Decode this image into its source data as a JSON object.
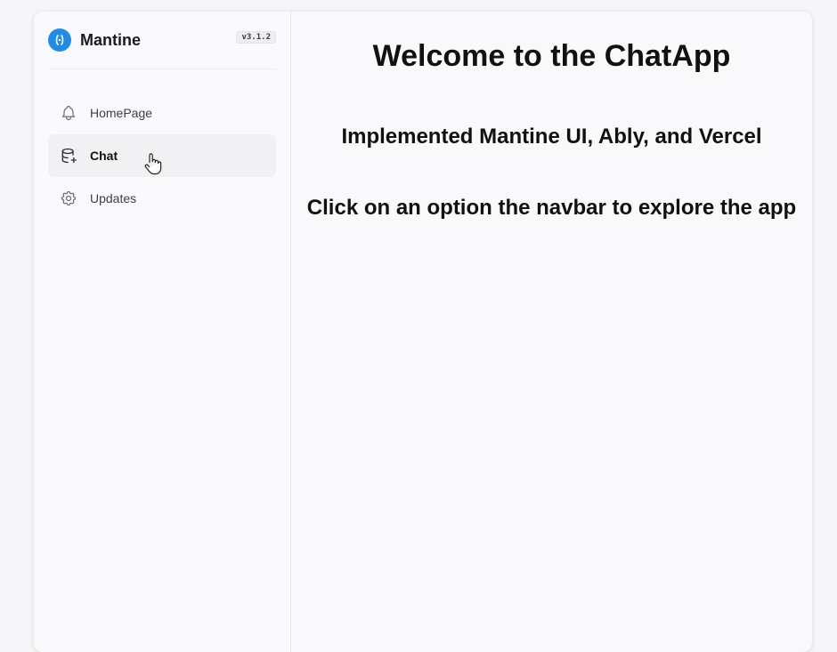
{
  "navbar": {
    "brand": "Mantine",
    "version": "v3.1.2",
    "items": [
      {
        "label": "HomePage",
        "icon": "bell-icon",
        "active": false
      },
      {
        "label": "Chat",
        "icon": "database-import-icon",
        "active": true
      },
      {
        "label": "Updates",
        "icon": "gear-icon",
        "active": false
      }
    ]
  },
  "main": {
    "title": "Welcome to the ChatApp",
    "subtitle": "Implemented Mantine UI, Ably, and Vercel",
    "hint": "Click on an option the navbar to explore the app"
  },
  "colors": {
    "accent": "#228be6",
    "active_bg": "#f1f1f4"
  }
}
